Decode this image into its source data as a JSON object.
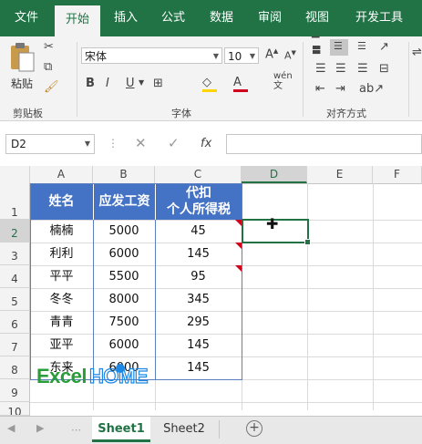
{
  "ribbon_tabs": [
    "文件",
    "开始",
    "插入",
    "公式",
    "数据",
    "审阅",
    "视图",
    "开发工具"
  ],
  "active_tab": "开始",
  "clipboard": {
    "paste_label": "粘贴",
    "group_label": "剪贴板"
  },
  "font": {
    "name": "宋体",
    "size": "10",
    "group_label": "字体",
    "phonetic": "wén"
  },
  "alignment": {
    "group_label": "对齐方式"
  },
  "name_box": "D2",
  "fx_label": "fx",
  "columns": [
    "A",
    "B",
    "C",
    "D",
    "E",
    "F"
  ],
  "rows": [
    "1",
    "2",
    "3",
    "4",
    "5",
    "6",
    "7",
    "8",
    "9",
    "10"
  ],
  "table": {
    "headers": [
      "姓名",
      "应发工资",
      "代扣",
      "个人所得税"
    ],
    "records": [
      [
        "楠楠",
        "5000",
        "45"
      ],
      [
        "利利",
        "6000",
        "145"
      ],
      [
        "平平",
        "5500",
        "95"
      ],
      [
        "冬冬",
        "8000",
        "345"
      ],
      [
        "青青",
        "7500",
        "295"
      ],
      [
        "亚平",
        "6000",
        "145"
      ],
      [
        "东来",
        "6000",
        "145"
      ]
    ]
  },
  "watermark": "ExcelHOME",
  "sheets": [
    "Sheet1",
    "Sheet2"
  ],
  "active_sheet": "Sheet1",
  "colors": {
    "accent": "#217346",
    "header_fill": "#4472c4",
    "comment_marker": "#d0021b"
  }
}
